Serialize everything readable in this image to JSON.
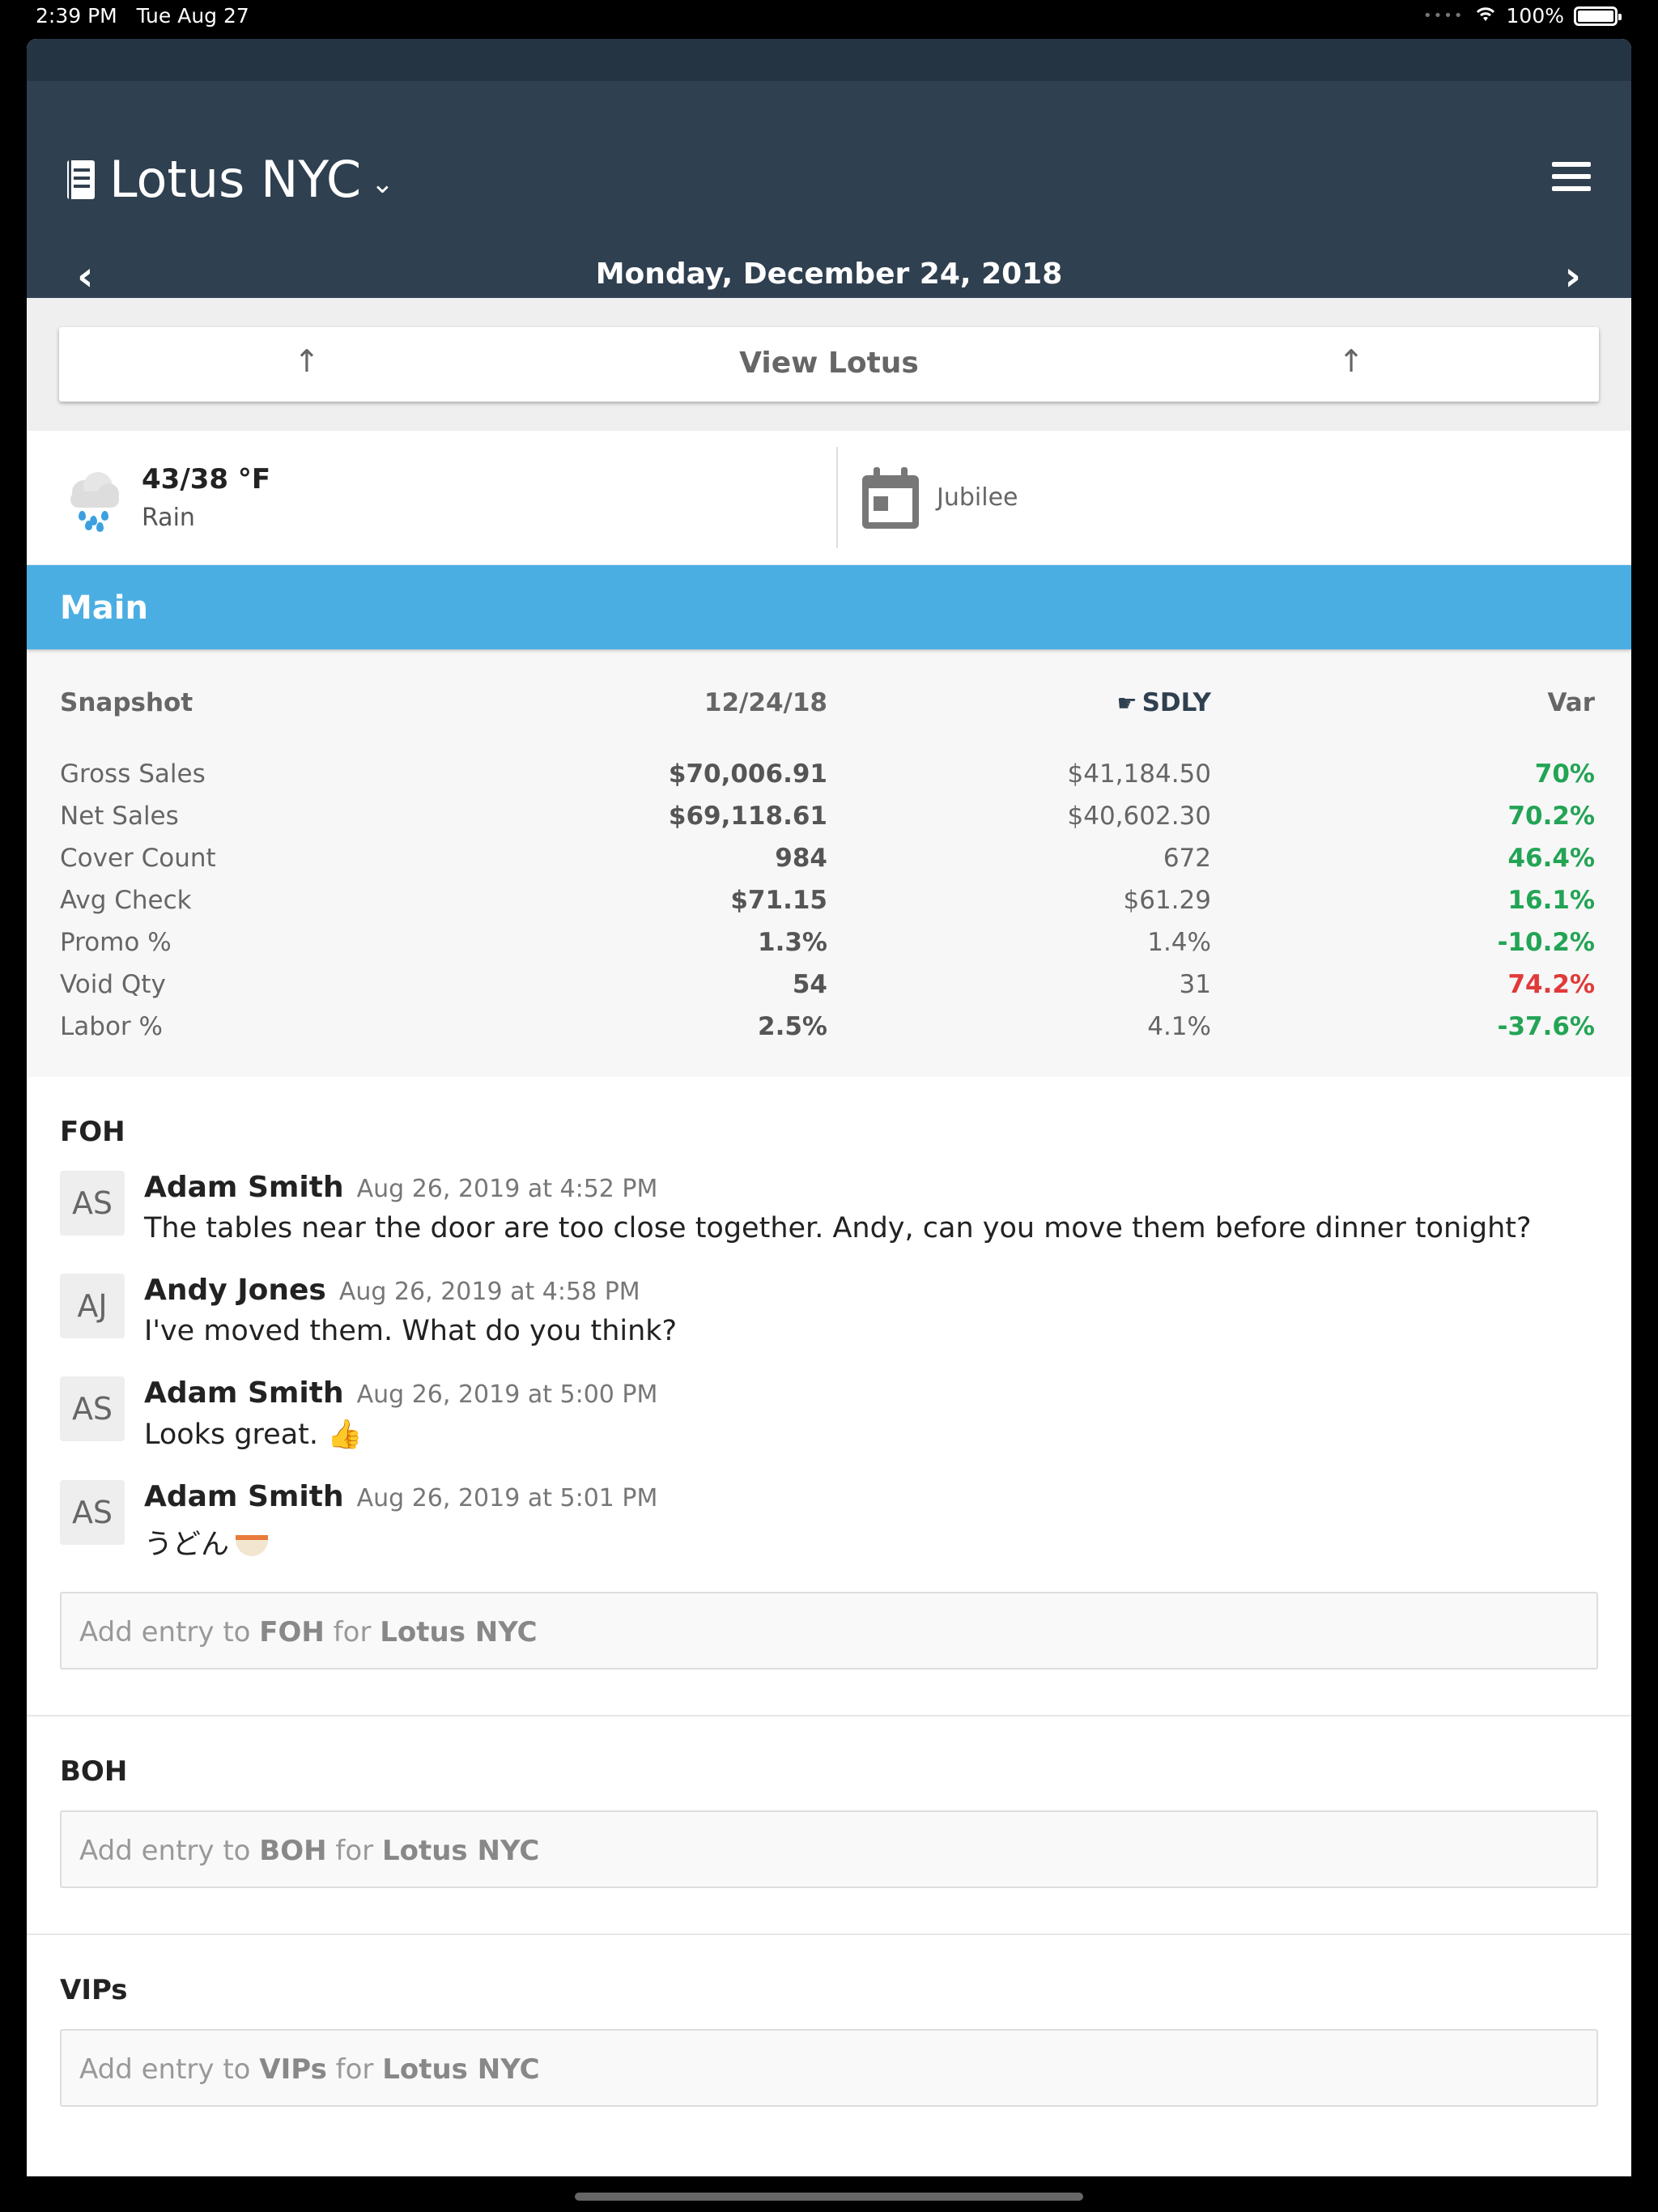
{
  "status": {
    "time": "2:39 PM",
    "date": "Tue Aug 27",
    "battery": "100%"
  },
  "header": {
    "venue": "Lotus NYC",
    "date": "Monday, December 24, 2018",
    "prev": "‹",
    "next": "›"
  },
  "viewbar": {
    "label": "View Lotus",
    "arrow": "↑"
  },
  "info": {
    "temp": "43/38 °F",
    "condition": "Rain",
    "event": "Jubilee"
  },
  "section": "Main",
  "snapshot": {
    "headers": [
      "Snapshot",
      "12/24/18",
      "SDLY",
      "Var"
    ],
    "rows": [
      [
        "Gross Sales",
        "$70,006.91",
        "$41,184.50",
        "70%"
      ],
      [
        "Net Sales",
        "$69,118.61",
        "$40,602.30",
        "70.2%"
      ],
      [
        "Cover Count",
        "984",
        "672",
        "46.4%"
      ],
      [
        "Avg Check",
        "$71.15",
        "$61.29",
        "16.1%"
      ],
      [
        "Promo %",
        "1.3%",
        "1.4%",
        "-10.2%"
      ],
      [
        "Void Qty",
        "54",
        "31",
        "74.2%"
      ],
      [
        "Labor %",
        "2.5%",
        "4.1%",
        "-37.6%"
      ]
    ],
    "var_colors": [
      "green",
      "green",
      "green",
      "green",
      "green",
      "red",
      "green"
    ]
  },
  "logs": [
    {
      "title": "FOH",
      "entries": [
        {
          "initials": "AS",
          "author": "Adam Smith",
          "stamp": "Aug 26, 2019 at 4:52 PM",
          "msg": "The tables near the door are too close together. Andy, can you move them before dinner tonight?"
        },
        {
          "initials": "AJ",
          "author": "Andy Jones",
          "stamp": "Aug 26, 2019 at 4:58 PM",
          "msg": "I've moved them. What do you think?"
        },
        {
          "initials": "AS",
          "author": "Adam Smith",
          "stamp": "Aug 26, 2019 at 5:00 PM",
          "msg": "Looks great. 👍"
        },
        {
          "initials": "AS",
          "author": "Adam Smith",
          "stamp": "Aug 26, 2019 at 5:01 PM",
          "msg": "うどん"
        }
      ],
      "add_prefix": "Add entry to ",
      "add_mid": " for ",
      "add_venue": "Lotus NYC"
    },
    {
      "title": "BOH",
      "entries": [],
      "add_prefix": "Add entry to ",
      "add_mid": " for ",
      "add_venue": "Lotus NYC"
    },
    {
      "title": "VIPs",
      "entries": [],
      "add_prefix": "Add entry to ",
      "add_mid": " for ",
      "add_venue": "Lotus NYC"
    }
  ],
  "colors": {
    "header": "#2f4050",
    "section": "#4baee3",
    "positive": "#23a455",
    "negative": "#e03a3a"
  }
}
